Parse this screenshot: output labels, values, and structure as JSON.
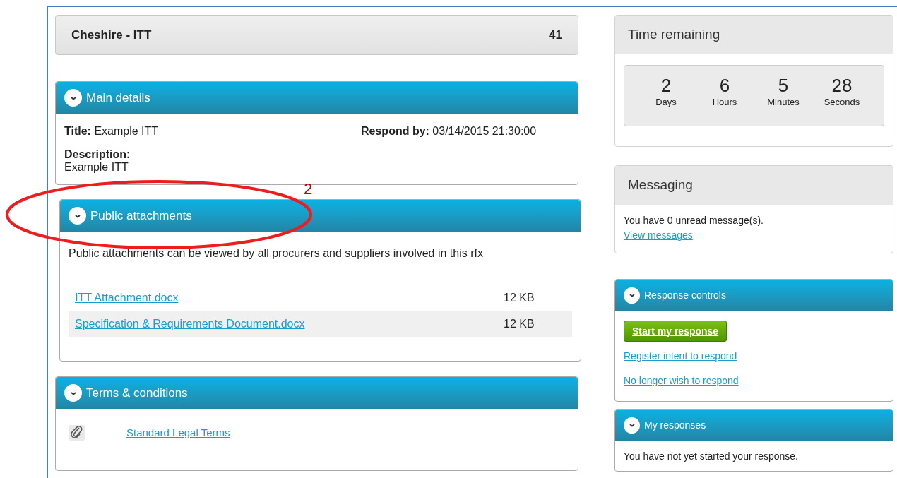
{
  "header": {
    "title": "Cheshire - ITT",
    "count": "41"
  },
  "main_details": {
    "title": "Main details",
    "expanded": true,
    "title_label": "Title:",
    "title_value": "Example ITT",
    "respond_label": "Respond by:",
    "respond_value": "03/14/2015 21:30:00",
    "description_label": "Description:",
    "description_value": "Example ITT"
  },
  "public_attachments": {
    "title": "Public attachments",
    "expanded": true,
    "note": "Public attachments can be viewed by all procurers and suppliers involved in this rfx",
    "files": [
      {
        "name": "ITT Attachment.docx",
        "size": "12 KB"
      },
      {
        "name": "Specification & Requirements Document.docx",
        "size": "12 KB"
      }
    ]
  },
  "terms": {
    "title": "Terms & conditions",
    "expanded": true,
    "link": "Standard Legal Terms"
  },
  "time_remaining": {
    "title": "Time remaining",
    "units": [
      {
        "value": "2",
        "label": "Days"
      },
      {
        "value": "6",
        "label": "Hours"
      },
      {
        "value": "5",
        "label": "Minutes"
      },
      {
        "value": "28",
        "label": "Seconds"
      }
    ]
  },
  "messaging": {
    "title": "Messaging",
    "text": "You have 0 unread message(s).",
    "link": "View messages"
  },
  "response_controls": {
    "title": "Response controls",
    "expanded": true,
    "button": "Start my response",
    "links": [
      "Register intent to respond",
      "No longer wish to respond"
    ]
  },
  "my_responses": {
    "title": "My responses",
    "expanded": true,
    "text": "You have not yet started your response."
  },
  "annotation": {
    "label": "2"
  }
}
